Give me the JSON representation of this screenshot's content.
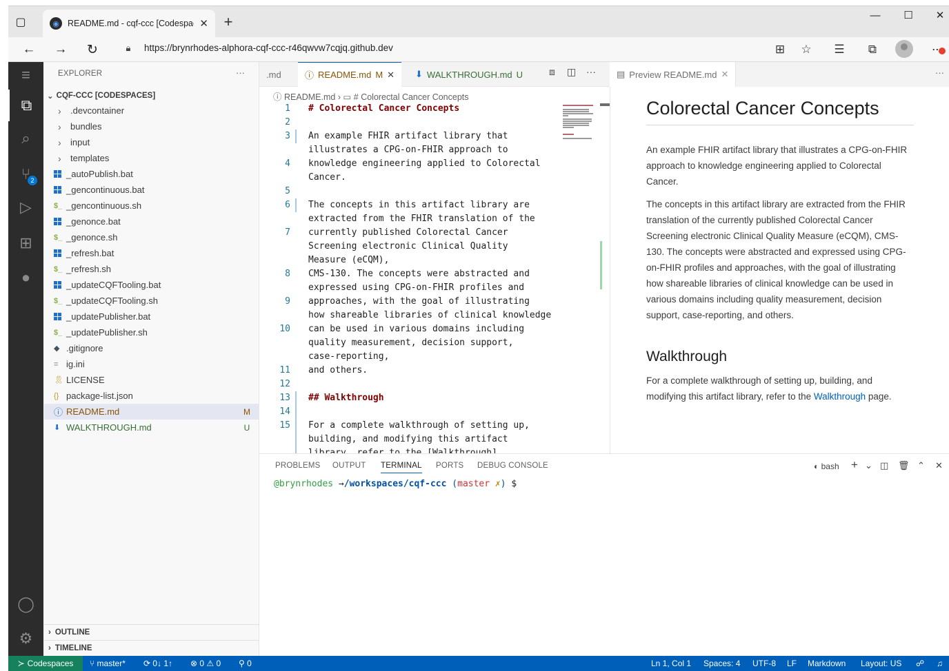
{
  "browser": {
    "tab_title": "README.md - cqf-ccc [Codespaces]",
    "url": "https://brynrhodes-alphora-cqf-ccc-r46qwvw7cqjq.github.dev"
  },
  "explorer": {
    "title": "EXPLORER",
    "root": "CQF-CCC [CODESPACES]",
    "items": [
      {
        "label": ".devcontainer",
        "kind": "folder",
        "badge": ""
      },
      {
        "label": "bundles",
        "kind": "folder",
        "badge": ""
      },
      {
        "label": "input",
        "kind": "folder",
        "badge": ""
      },
      {
        "label": "templates",
        "kind": "folder",
        "badge": ""
      },
      {
        "label": "_autoPublish.bat",
        "kind": "bat",
        "badge": ""
      },
      {
        "label": "_gencontinuous.bat",
        "kind": "bat",
        "badge": ""
      },
      {
        "label": "_gencontinuous.sh",
        "kind": "sh",
        "badge": ""
      },
      {
        "label": "_genonce.bat",
        "kind": "bat",
        "badge": ""
      },
      {
        "label": "_genonce.sh",
        "kind": "sh",
        "badge": ""
      },
      {
        "label": "_refresh.bat",
        "kind": "bat",
        "badge": ""
      },
      {
        "label": "_refresh.sh",
        "kind": "sh",
        "badge": ""
      },
      {
        "label": "_updateCQFTooling.bat",
        "kind": "bat",
        "badge": ""
      },
      {
        "label": "_updateCQFTooling.sh",
        "kind": "sh",
        "badge": ""
      },
      {
        "label": "_updatePublisher.bat",
        "kind": "bat",
        "badge": ""
      },
      {
        "label": "_updatePublisher.sh",
        "kind": "sh",
        "badge": ""
      },
      {
        "label": ".gitignore",
        "kind": "git",
        "badge": ""
      },
      {
        "label": "ig.ini",
        "kind": "ini",
        "badge": ""
      },
      {
        "label": "LICENSE",
        "kind": "license",
        "badge": ""
      },
      {
        "label": "package-list.json",
        "kind": "json",
        "badge": ""
      },
      {
        "label": "README.md",
        "kind": "info",
        "badge": "M"
      },
      {
        "label": "WALKTHROUGH.md",
        "kind": "md",
        "badge": "U"
      }
    ],
    "outline": "OUTLINE",
    "timeline": "TIMELINE"
  },
  "activity": {
    "scm_badge": "2"
  },
  "editor": {
    "tab_prev": ".md",
    "tab_active": "README.md",
    "tab_active_badge": "M",
    "tab_walk": "WALKTHROUGH.md",
    "tab_walk_badge": "U",
    "breadcrumb_file": "README.md",
    "breadcrumb_symbol": "# Colorectal Cancer Concepts",
    "gutter": [
      "1",
      "2",
      "3",
      "",
      "4",
      "",
      "5",
      "6",
      "",
      "7",
      "",
      "",
      "8",
      "",
      "9",
      "",
      "10",
      "",
      "",
      "11",
      "12",
      "13",
      "14",
      "15",
      "",
      ""
    ],
    "lines": [
      "# Colorectal Cancer Concepts",
      "",
      "An example FHIR artifact library that",
      "illustrates a CPG-on-FHIR approach to",
      "knowledge engineering applied to Colorectal",
      "Cancer.",
      "",
      "The concepts in this artifact library are",
      "extracted from the FHIR translation of the",
      "currently published Colorectal Cancer",
      "Screening electronic Clinical Quality",
      "Measure (eCQM),",
      "CMS-130. The concepts were abstracted and",
      "expressed using CPG-on-FHIR profiles and",
      "approaches, with the goal of illustrating",
      "how shareable libraries of clinical knowledge",
      "can be used in various domains including",
      "quality measurement, decision support,",
      "case-reporting,",
      "and others.",
      "",
      "## Walkthrough",
      "",
      "For a complete walkthrough of setting up,",
      "building, and modifying this artifact",
      "library, refer to the [Walkthrough]"
    ]
  },
  "preview": {
    "tab": "Preview README.md",
    "h1": "Colorectal Cancer Concepts",
    "p1": "An example FHIR artifact library that illustrates a CPG-on-FHIR approach to knowledge engineering applied to Colorectal Cancer.",
    "p2": "The concepts in this artifact library are extracted from the FHIR translation of the currently published Colorectal Cancer Screening electronic Clinical Quality Measure (eCQM), CMS-130. The concepts were abstracted and expressed using CPG-on-FHIR profiles and approaches, with the goal of illustrating how shareable libraries of clinical knowledge can be used in various domains including quality measurement, decision support, case-reporting, and others.",
    "h2": "Walkthrough",
    "p3_before": "For a complete walkthrough of setting up, building, and modifying this artifact library, refer to the ",
    "p3_link": "Walkthrough",
    "p3_after": " page."
  },
  "panel": {
    "tabs": [
      "PROBLEMS",
      "OUTPUT",
      "TERMINAL",
      "PORTS",
      "DEBUG CONSOLE"
    ],
    "active_tab": "TERMINAL",
    "shell": "bash",
    "term_user": "@brynrhodes",
    "term_arrow": "→",
    "term_path": "/workspaces/cqf-ccc",
    "term_branch_open": "(",
    "term_branch": "master",
    "term_x": "✗",
    "term_branch_close": ")",
    "term_prompt": "$"
  },
  "status": {
    "remote": "Codespaces",
    "branch": "master*",
    "sync": "0↓ 1↑",
    "errors": "0",
    "warnings": "0",
    "ports": "0",
    "position": "Ln 1, Col 1",
    "spaces": "Spaces: 4",
    "encoding": "UTF-8",
    "eol": "LF",
    "language": "Markdown",
    "layout": "Layout: US"
  },
  "colors": {
    "accent": "#005fb8",
    "remote": "#16825d",
    "modified": "#895503",
    "untracked": "#386f36",
    "activitybar": "#2c2c2c"
  }
}
